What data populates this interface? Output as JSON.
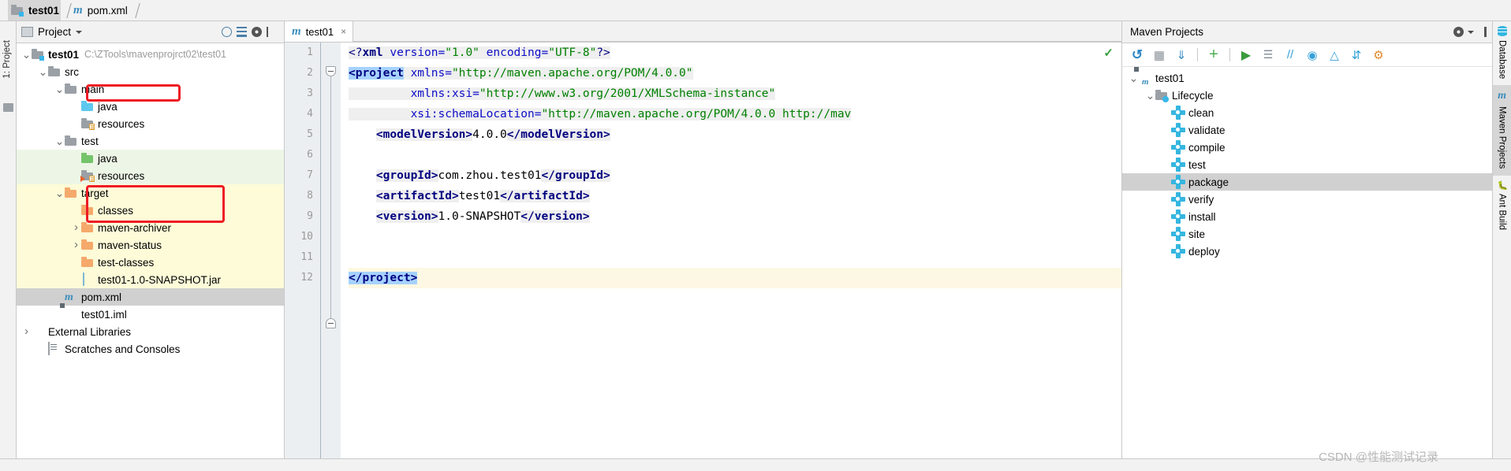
{
  "breadcrumb": {
    "items": [
      {
        "label": "test01",
        "icon": "module-folder-icon",
        "selected": true,
        "bold": true
      },
      {
        "label": "pom.xml",
        "icon": "maven-file-icon",
        "selected": false,
        "bold": false
      }
    ]
  },
  "left_strip": {
    "label": "1: Project",
    "icon": "project-tool-icon"
  },
  "project_panel": {
    "title": "Project",
    "toolbar_icons": [
      "locate-icon",
      "collapse-all-icon",
      "gear-icon",
      "hide-icon"
    ],
    "tree": [
      {
        "label": "test01",
        "path": "C:\\ZTools\\mavenprojrct02\\test01",
        "depth": 0,
        "arrow": "down",
        "icon": "module-folder-icon",
        "bold": true,
        "row_bg": "none"
      },
      {
        "label": "src",
        "path": "",
        "depth": 1,
        "arrow": "down",
        "icon": "folder-gray-icon",
        "bold": false,
        "row_bg": "none"
      },
      {
        "label": "main",
        "path": "",
        "depth": 2,
        "arrow": "down",
        "icon": "folder-gray-icon",
        "bold": false,
        "row_bg": "none"
      },
      {
        "label": "java",
        "path": "",
        "depth": 3,
        "arrow": "none",
        "icon": "folder-sources-blue-icon",
        "bold": false,
        "row_bg": "none"
      },
      {
        "label": "resources",
        "path": "",
        "depth": 3,
        "arrow": "none",
        "icon": "folder-resources-icon",
        "bold": false,
        "row_bg": "none"
      },
      {
        "label": "test",
        "path": "",
        "depth": 2,
        "arrow": "down",
        "icon": "folder-gray-icon",
        "bold": false,
        "row_bg": "none"
      },
      {
        "label": "java",
        "path": "",
        "depth": 3,
        "arrow": "none",
        "icon": "folder-test-sources-green-icon",
        "bold": false,
        "row_bg": "green"
      },
      {
        "label": "resources",
        "path": "",
        "depth": 3,
        "arrow": "none",
        "icon": "folder-test-resources-icon",
        "bold": false,
        "row_bg": "green"
      },
      {
        "label": "target",
        "path": "",
        "depth": 2,
        "arrow": "down",
        "icon": "folder-excluded-orange-icon",
        "bold": false,
        "row_bg": "yellow"
      },
      {
        "label": "classes",
        "path": "",
        "depth": 3,
        "arrow": "none",
        "icon": "folder-excluded-orange-icon",
        "bold": false,
        "row_bg": "yellow"
      },
      {
        "label": "maven-archiver",
        "path": "",
        "depth": 3,
        "arrow": "right",
        "icon": "folder-excluded-orange-icon",
        "bold": false,
        "row_bg": "yellow"
      },
      {
        "label": "maven-status",
        "path": "",
        "depth": 3,
        "arrow": "right",
        "icon": "folder-excluded-orange-icon",
        "bold": false,
        "row_bg": "yellow"
      },
      {
        "label": "test-classes",
        "path": "",
        "depth": 3,
        "arrow": "none",
        "icon": "folder-excluded-orange-icon",
        "bold": false,
        "row_bg": "yellow"
      },
      {
        "label": "test01-1.0-SNAPSHOT.jar",
        "path": "",
        "depth": 3,
        "arrow": "none",
        "icon": "jar-file-icon",
        "bold": false,
        "row_bg": "yellow"
      },
      {
        "label": "pom.xml",
        "path": "",
        "depth": 2,
        "arrow": "none",
        "icon": "maven-file-icon",
        "bold": false,
        "row_bg": "selected"
      },
      {
        "label": "test01.iml",
        "path": "",
        "depth": 2,
        "arrow": "none",
        "icon": "iml-file-icon",
        "bold": false,
        "row_bg": "none"
      },
      {
        "label": "External Libraries",
        "path": "",
        "depth": 0,
        "arrow": "right",
        "icon": "libraries-icon",
        "bold": false,
        "row_bg": "none"
      },
      {
        "label": "Scratches and Consoles",
        "path": "",
        "depth": 1,
        "arrow": "none",
        "icon": "scratches-icon",
        "bold": false,
        "row_bg": "none"
      }
    ]
  },
  "editor": {
    "tab": {
      "label": "test01",
      "icon": "maven-file-icon",
      "close": "×"
    },
    "inspection_status": "✓",
    "line_numbers": [
      "1",
      "2",
      "3",
      "4",
      "5",
      "6",
      "7",
      "8",
      "9",
      "10",
      "11",
      "12"
    ],
    "lines": [
      {
        "n": 1,
        "caret": false,
        "segments": [
          {
            "t": "<?",
            "c": "punc",
            "hl": true
          },
          {
            "t": "xml",
            "c": "tag",
            "hl": true
          },
          {
            "t": " version=",
            "c": "ns",
            "hl": true
          },
          {
            "t": "\"1.0\"",
            "c": "val",
            "hl": true
          },
          {
            "t": " encoding=",
            "c": "ns",
            "hl": true
          },
          {
            "t": "\"UTF-8\"",
            "c": "val",
            "hl": true
          },
          {
            "t": "?>",
            "c": "punc",
            "hl": true
          }
        ]
      },
      {
        "n": 2,
        "caret": false,
        "segments": [
          {
            "t": "<project",
            "c": "tag",
            "hl": false,
            "sel": true
          },
          {
            "t": " xmlns=",
            "c": "ns",
            "hl": true
          },
          {
            "t": "\"http://maven.apache.org/POM/4.0.0\"",
            "c": "val",
            "hl": true
          }
        ]
      },
      {
        "n": 3,
        "caret": false,
        "segments": [
          {
            "t": "         xmlns:xsi=",
            "c": "ns",
            "hl": true
          },
          {
            "t": "\"http://www.w3.org/2001/XMLSchema-instance\"",
            "c": "val",
            "hl": true
          }
        ]
      },
      {
        "n": 4,
        "caret": false,
        "segments": [
          {
            "t": "         xsi:schemaLocation=",
            "c": "ns",
            "hl": true
          },
          {
            "t": "\"http://maven.apache.org/POM/4.0.0 http://mav",
            "c": "val",
            "hl": true
          }
        ]
      },
      {
        "n": 5,
        "caret": false,
        "segments": [
          {
            "t": "    ",
            "c": "txt",
            "hl": false
          },
          {
            "t": "<modelVersion>",
            "c": "tag",
            "hl": true
          },
          {
            "t": "4.0.0",
            "c": "txt",
            "hl": false
          },
          {
            "t": "</modelVersion>",
            "c": "tag",
            "hl": true
          }
        ]
      },
      {
        "n": 6,
        "caret": false,
        "segments": []
      },
      {
        "n": 7,
        "caret": false,
        "segments": [
          {
            "t": "    ",
            "c": "txt",
            "hl": false
          },
          {
            "t": "<groupId>",
            "c": "tag",
            "hl": true
          },
          {
            "t": "com.zhou.test01",
            "c": "txt",
            "hl": false
          },
          {
            "t": "</groupId>",
            "c": "tag",
            "hl": true
          }
        ]
      },
      {
        "n": 8,
        "caret": false,
        "segments": [
          {
            "t": "    ",
            "c": "txt",
            "hl": false
          },
          {
            "t": "<artifactId>",
            "c": "tag",
            "hl": true
          },
          {
            "t": "test01",
            "c": "txt",
            "hl": false
          },
          {
            "t": "</artifactId>",
            "c": "tag",
            "hl": true
          }
        ]
      },
      {
        "n": 9,
        "caret": false,
        "segments": [
          {
            "t": "    ",
            "c": "txt",
            "hl": false
          },
          {
            "t": "<version>",
            "c": "tag",
            "hl": true
          },
          {
            "t": "1.0-SNAPSHOT",
            "c": "txt",
            "hl": false
          },
          {
            "t": "</version>",
            "c": "tag",
            "hl": true
          }
        ]
      },
      {
        "n": 10,
        "caret": false,
        "segments": []
      },
      {
        "n": 11,
        "caret": false,
        "segments": []
      },
      {
        "n": 12,
        "caret": true,
        "segments": [
          {
            "t": "</project>",
            "c": "tag",
            "hl": false,
            "sel": true
          }
        ]
      }
    ]
  },
  "maven_panel": {
    "title": "Maven Projects",
    "toolbar_icons": [
      "reimport-icon",
      "generate-sources-icon",
      "download-sources-icon",
      "add-maven-project-icon",
      "run-icon",
      "execute-goal-icon",
      "toggle-skip-tests-icon",
      "toggle-offline-icon",
      "show-dependencies-icon",
      "collapse-all-icon",
      "maven-settings-icon"
    ],
    "header_icons": [
      "gear-icon",
      "hide-icon"
    ],
    "tree": [
      {
        "label": "test01",
        "depth": 0,
        "arrow": "down",
        "icon": "maven-project-icon",
        "selected": false
      },
      {
        "label": "Lifecycle",
        "depth": 1,
        "arrow": "down",
        "icon": "lifecycle-folder-icon",
        "selected": false
      },
      {
        "label": "clean",
        "depth": 2,
        "arrow": "none",
        "icon": "maven-goal-gear-icon",
        "selected": false
      },
      {
        "label": "validate",
        "depth": 2,
        "arrow": "none",
        "icon": "maven-goal-gear-icon",
        "selected": false
      },
      {
        "label": "compile",
        "depth": 2,
        "arrow": "none",
        "icon": "maven-goal-gear-icon",
        "selected": false
      },
      {
        "label": "test",
        "depth": 2,
        "arrow": "none",
        "icon": "maven-goal-gear-icon",
        "selected": false
      },
      {
        "label": "package",
        "depth": 2,
        "arrow": "none",
        "icon": "maven-goal-gear-icon",
        "selected": true
      },
      {
        "label": "verify",
        "depth": 2,
        "arrow": "none",
        "icon": "maven-goal-gear-icon",
        "selected": false
      },
      {
        "label": "install",
        "depth": 2,
        "arrow": "none",
        "icon": "maven-goal-gear-icon",
        "selected": false
      },
      {
        "label": "site",
        "depth": 2,
        "arrow": "none",
        "icon": "maven-goal-gear-icon",
        "selected": false
      },
      {
        "label": "deploy",
        "depth": 2,
        "arrow": "none",
        "icon": "maven-goal-gear-icon",
        "selected": false
      }
    ]
  },
  "right_strip": {
    "items": [
      {
        "label": "Database",
        "icon": "database-icon",
        "active": false
      },
      {
        "label": "Maven Projects",
        "icon": "maven-m-icon",
        "active": true
      },
      {
        "label": "Ant Build",
        "icon": "ant-icon",
        "active": false
      }
    ]
  },
  "watermark": "CSDN @性能测试记录",
  "colors": {
    "accent_blue": "#38b6e8",
    "annotation_red": "#ee1c25",
    "selection_blue": "#a6d2ff",
    "test_source_green": "#edf6e6",
    "excluded_yellow": "#fdfbd8"
  }
}
